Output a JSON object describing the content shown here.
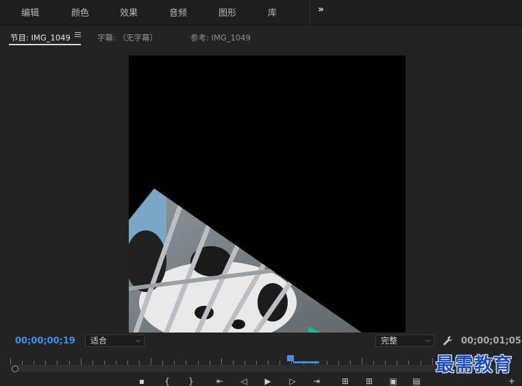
{
  "workspaces": {
    "items": [
      "编辑",
      "颜色",
      "效果",
      "音频",
      "图形",
      "库"
    ],
    "more_label": "»"
  },
  "panel": {
    "tabs": [
      {
        "label": "节目: IMG_1049",
        "active": true
      },
      {
        "label": "字幕: （无字幕）",
        "active": false
      },
      {
        "label": "参考: IMG_1049",
        "active": false
      }
    ]
  },
  "monitor": {
    "current_timecode": "00;00;00;19",
    "duration_timecode": "00;00;01;05",
    "zoom_select": "适合",
    "resolution_select": "完整"
  },
  "colors": {
    "accent": "#3d8fe8",
    "background": "#232323",
    "watermark": "#1f4fb8"
  },
  "watermark": {
    "text": "最需教育"
  }
}
